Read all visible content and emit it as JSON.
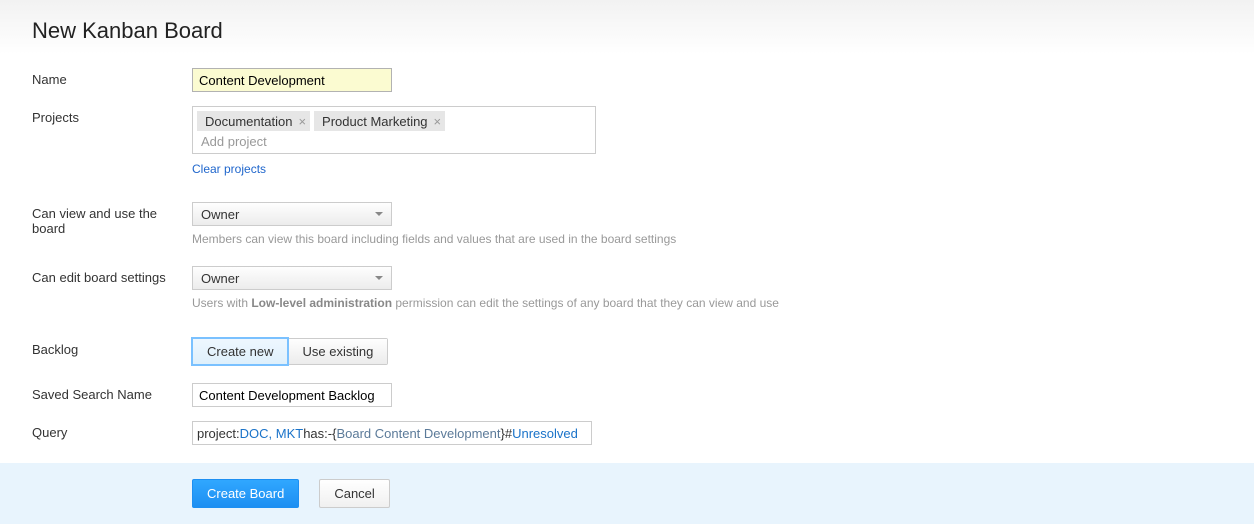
{
  "page": {
    "title": "New Kanban Board"
  },
  "labels": {
    "name": "Name",
    "projects": "Projects",
    "can_view": "Can view and use the board",
    "can_edit": "Can edit board settings",
    "backlog": "Backlog",
    "saved_search": "Saved Search Name",
    "query": "Query"
  },
  "fields": {
    "name_value": "Content Development",
    "project_tags": [
      "Documentation",
      "Product Marketing"
    ],
    "add_project_placeholder": "Add project",
    "clear_projects": "Clear projects",
    "view_owner": "Owner",
    "view_hint": "Members can view this board including fields and values that are used in the board settings",
    "edit_owner": "Owner",
    "edit_hint_pre": "Users with ",
    "edit_hint_bold": "Low-level administration",
    "edit_hint_post": " permission can edit the settings of any board that they can view and use",
    "seg_create": "Create new",
    "seg_use": "Use existing",
    "saved_search_value": "Content Development Backlog",
    "query": {
      "p1": "project: ",
      "p2": "DOC, MKT",
      "p3": " has: ",
      "p4": "-{",
      "p5": "Board Content Development",
      "p6": "}",
      "p7": " #",
      "p8": "Unresolved"
    }
  },
  "buttons": {
    "create": "Create Board",
    "cancel": "Cancel"
  }
}
